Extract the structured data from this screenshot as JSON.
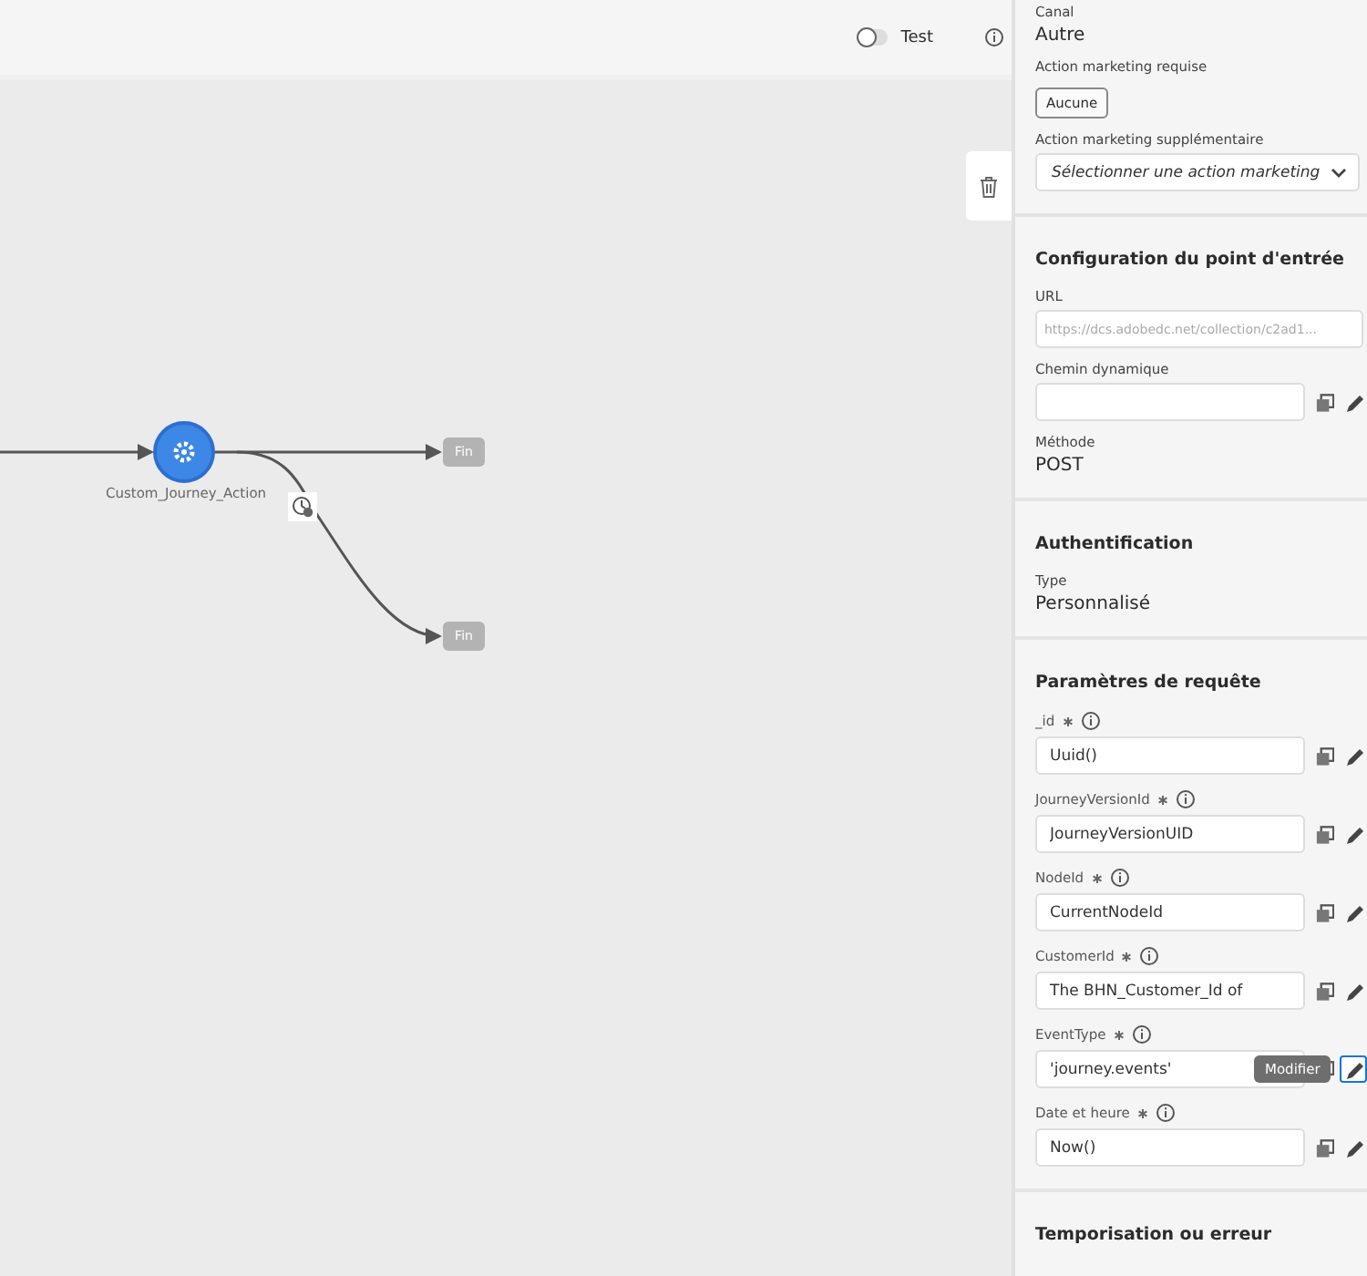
{
  "toolbar": {
    "test_toggle": {
      "label": "Test",
      "on": false
    }
  },
  "canvas": {
    "action_node": {
      "label": "Custom_Journey_Action"
    },
    "end_nodes": [
      {
        "label": "Fin"
      },
      {
        "label": "Fin"
      }
    ]
  },
  "panel": {
    "channel": {
      "label": "Canal",
      "value": "Autre"
    },
    "required_marketing_action": {
      "label": "Action marketing requise",
      "tag": "Aucune"
    },
    "extra_marketing_action": {
      "label": "Action marketing supplémentaire",
      "placeholder": "Sélectionner une action marketing"
    },
    "sections": [
      {
        "kind": "endpoint",
        "title": "Configuration du point d'entrée",
        "url": {
          "label": "URL",
          "placeholder": "https://dcs.adobedc.net/collection/c2ad1..."
        },
        "dynamic_path": {
          "label": "Chemin dynamique"
        },
        "method": {
          "label": "Méthode",
          "value": "POST"
        }
      },
      {
        "kind": "auth",
        "title": "Authentification",
        "type": {
          "label": "Type",
          "value": "Personnalisé"
        }
      },
      {
        "kind": "params",
        "title": "Paramètres de requête",
        "params": [
          {
            "name": "_id",
            "required": true,
            "value": "Uuid()",
            "edit_focused": false
          },
          {
            "name": "JourneyVersionId",
            "required": true,
            "value": "JourneyVersionUID",
            "edit_focused": false
          },
          {
            "name": "NodeId",
            "required": true,
            "value": "CurrentNodeId",
            "edit_focused": false
          },
          {
            "name": "CustomerId",
            "required": true,
            "value": "The BHN_Customer_Id of",
            "edit_focused": false
          },
          {
            "name": "EventType",
            "required": true,
            "value": "'journey.events'",
            "edit_focused": true,
            "tooltip": "Modifier"
          },
          {
            "name": "Date et heure",
            "required": true,
            "value": "Now()",
            "edit_focused": false
          }
        ]
      },
      {
        "kind": "title_only",
        "title": "Temporisation ou erreur"
      }
    ]
  }
}
